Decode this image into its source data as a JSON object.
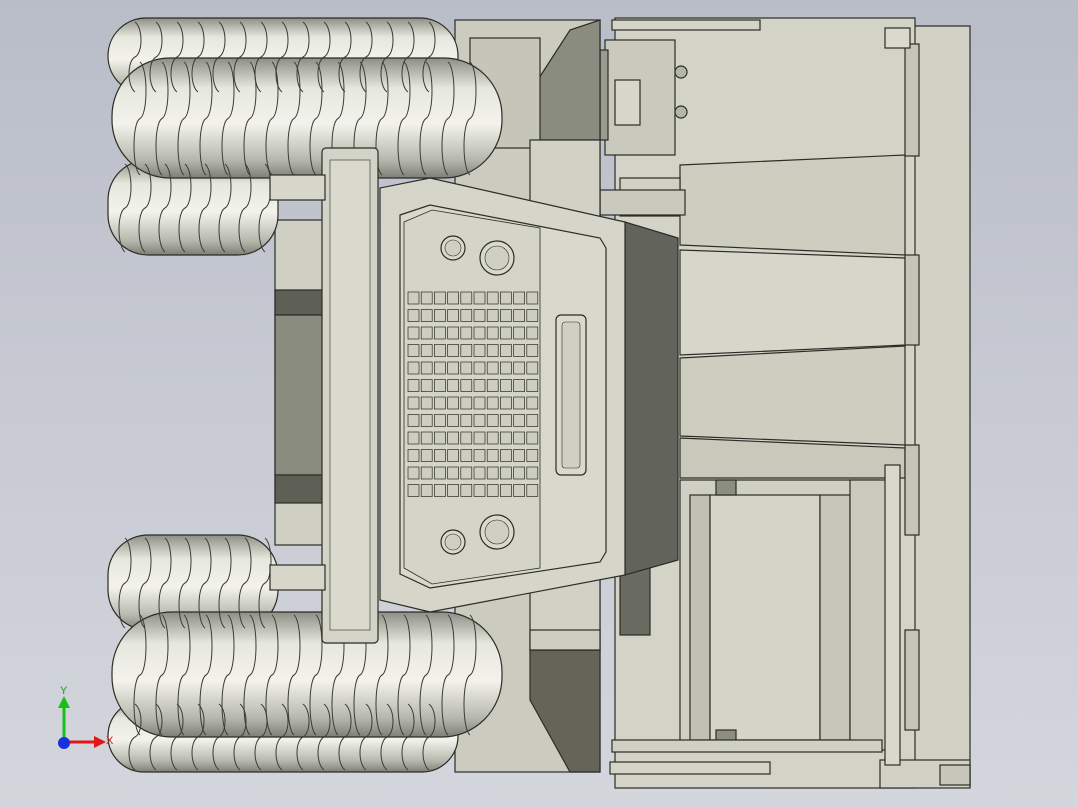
{
  "viewport": {
    "background_top": "#b9bdc8",
    "background_bottom": "#d4d6dd"
  },
  "model": {
    "body_color": "#d0d1c3",
    "shadow_color": "#8c8e82",
    "dark_color": "#606058",
    "line_color": "#2b2c26",
    "tire_color": "#c6c7bd",
    "grille_rows": 12
  },
  "triad": {
    "x_label": "X",
    "y_label": "Y",
    "x_color": "#e01818",
    "y_color": "#18c018",
    "z_color": "#1830e0"
  }
}
